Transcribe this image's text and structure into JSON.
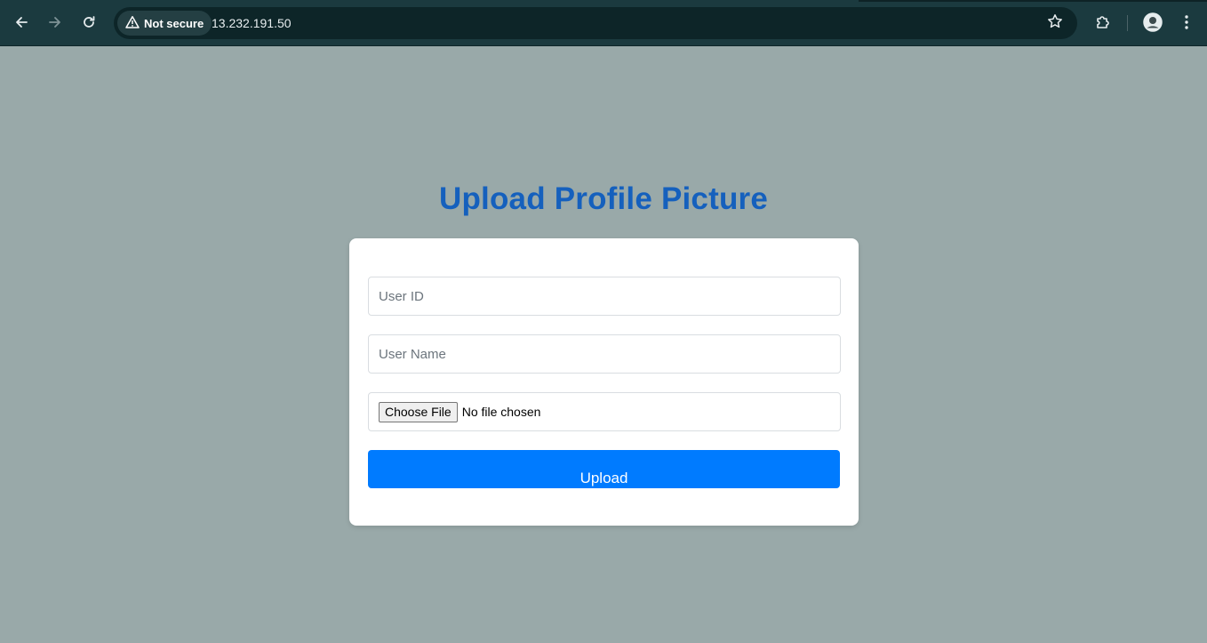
{
  "browser": {
    "security_label": "Not secure",
    "url": "13.232.191.50",
    "icons": {
      "back": "back-arrow-icon",
      "forward": "forward-arrow-icon",
      "reload": "reload-icon",
      "warning": "warning-triangle-icon",
      "bookmark": "star-icon",
      "extensions": "puzzle-icon",
      "profile": "avatar-icon",
      "menu": "kebab-menu-icon"
    },
    "colors": {
      "toolbar": "#1b3a3f",
      "omnibox": "#0d2528"
    }
  },
  "page": {
    "background": "#99a9a9",
    "title": "Upload Profile Picture",
    "title_color": "#1560bd",
    "form": {
      "user_id_placeholder": "User ID",
      "user_id_value": "",
      "user_name_placeholder": "User Name",
      "user_name_value": "",
      "choose_file_label": "Choose File",
      "file_status": "No file chosen",
      "upload_label": "Upload",
      "upload_color": "#007bff"
    }
  }
}
